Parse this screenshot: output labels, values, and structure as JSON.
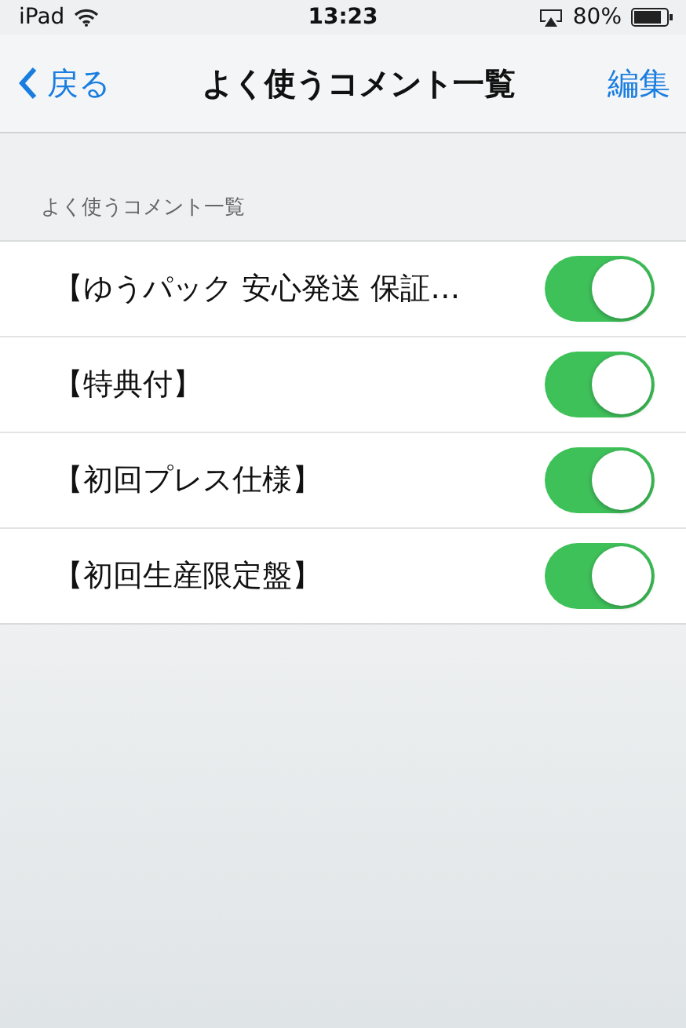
{
  "status_bar": {
    "device": "iPad",
    "time": "13:23",
    "battery": "80%"
  },
  "nav_bar": {
    "back": "戻る",
    "title": "よく使うコメント一覧",
    "action": "編集"
  },
  "section": {
    "header": "よく使うコメント一覧",
    "rows": [
      {
        "label": "【ゆうパック 安心発送 保証…",
        "on": true
      },
      {
        "label": "【特典付】",
        "on": true
      },
      {
        "label": "【初回プレス仕様】",
        "on": true
      },
      {
        "label": "【初回生産限定盤】",
        "on": true
      }
    ]
  }
}
